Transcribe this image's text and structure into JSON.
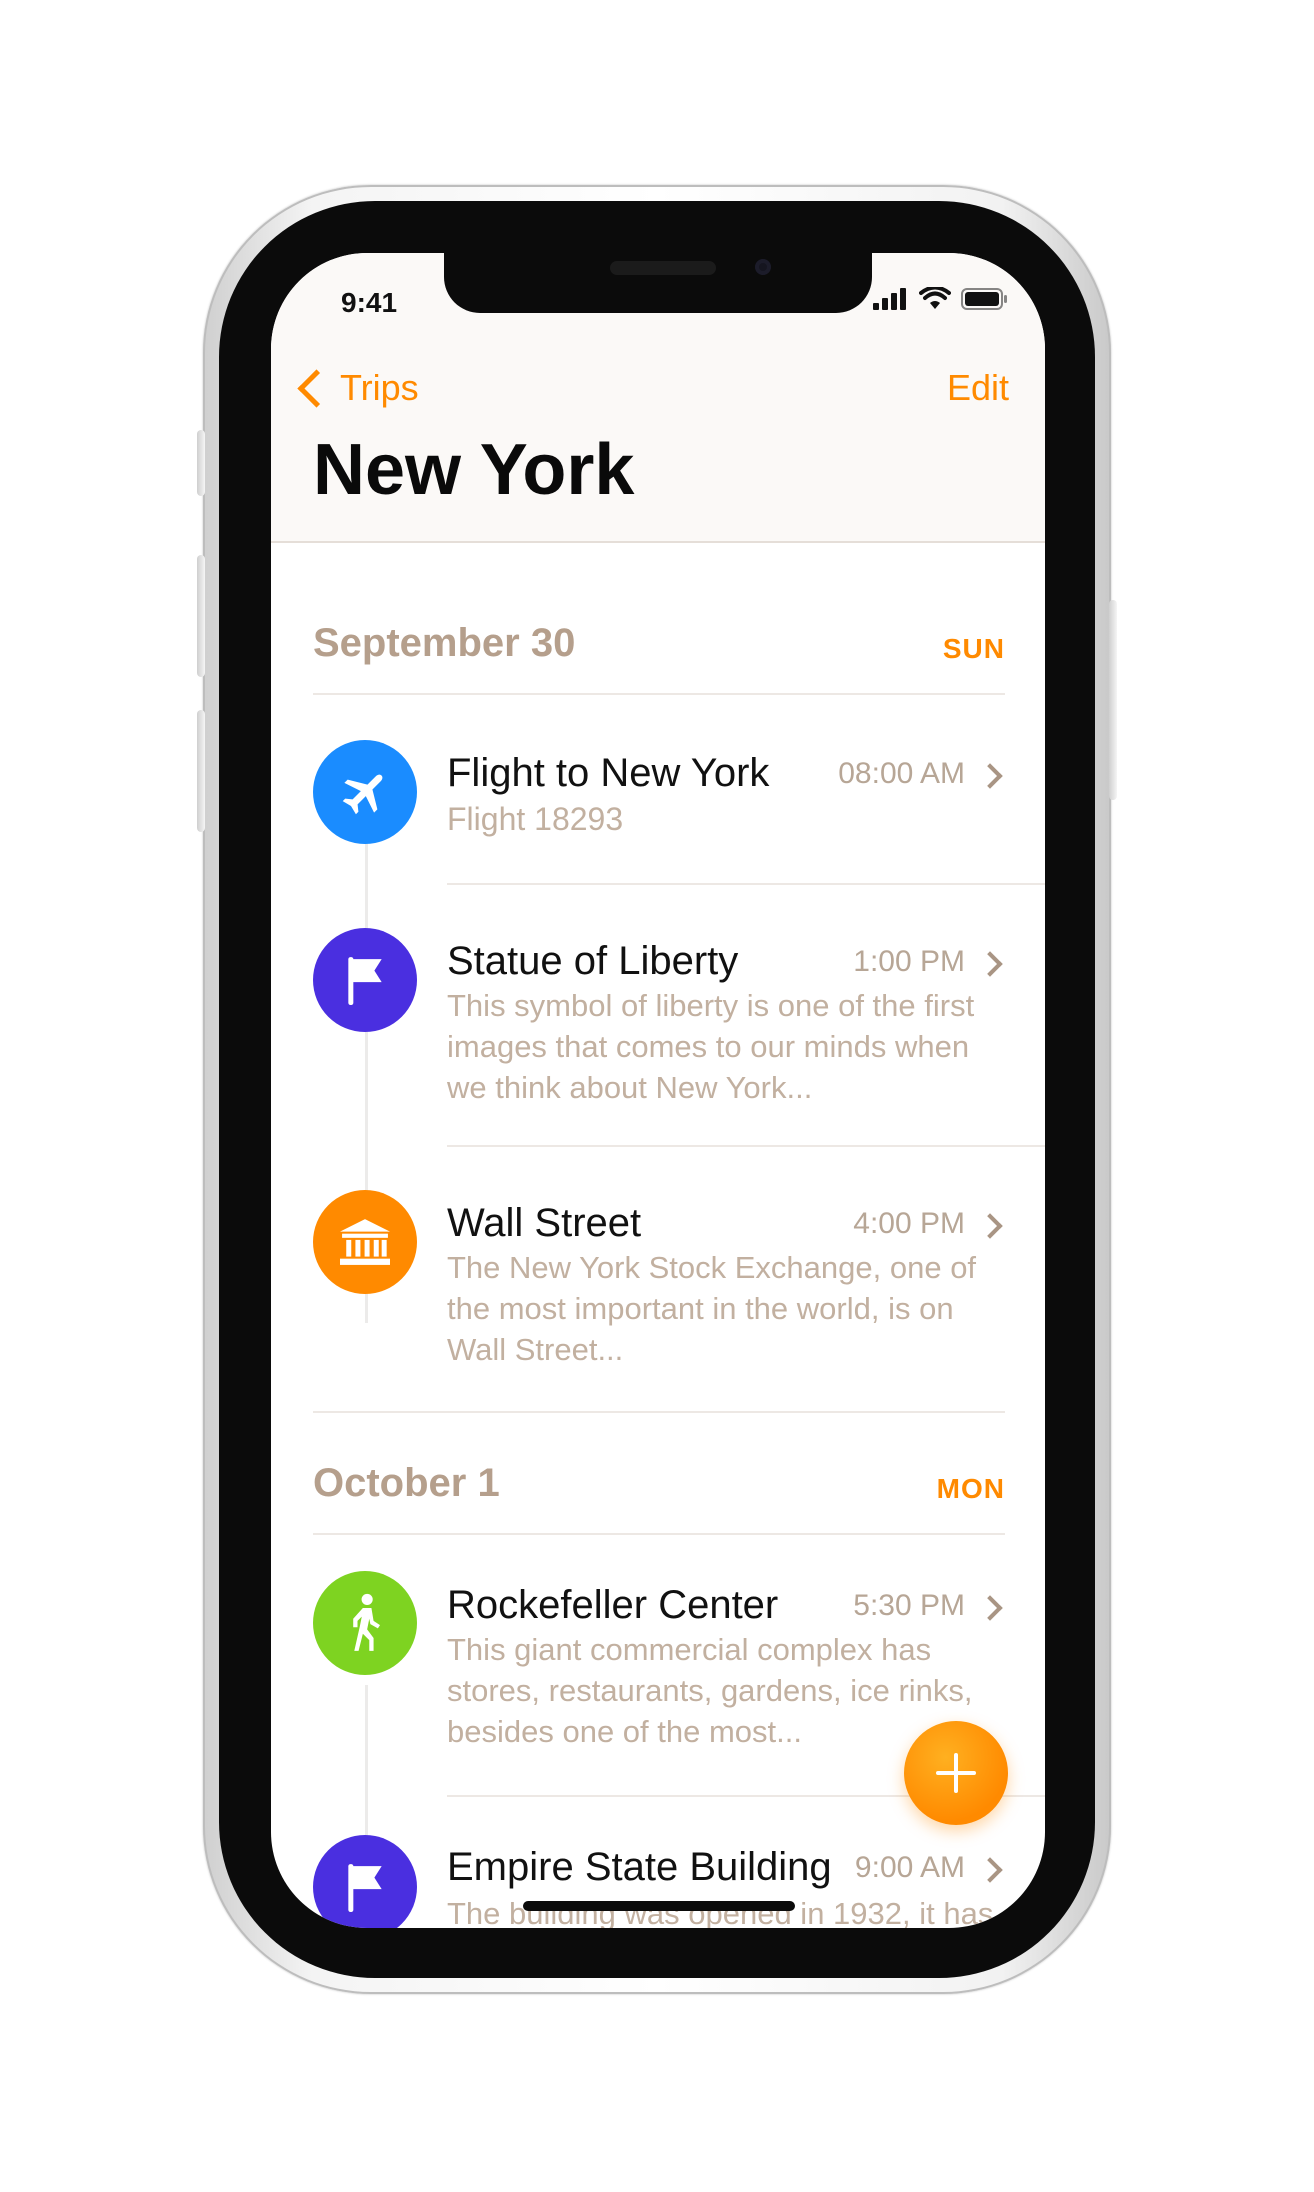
{
  "status_bar": {
    "time": "9:41"
  },
  "nav": {
    "back_label": "Trips",
    "edit_label": "Edit",
    "title": "New York"
  },
  "colors": {
    "accent": "#ff8a00",
    "flight": "#1a8cff",
    "landmark": "#4a2fe0",
    "finance": "#ff8a00",
    "walk": "#7ed321"
  },
  "sections": [
    {
      "date": "September 30",
      "day": "SUN",
      "items": [
        {
          "title": "Flight to New York",
          "time": "08:00 AM",
          "subtitle": "Flight 18293",
          "icon": "airplane-icon"
        },
        {
          "title": "Statue of Liberty",
          "time": "1:00 PM",
          "description": "This symbol of liberty is one of the first images that comes to our minds when we think about New York...",
          "icon": "flag-icon"
        },
        {
          "title": "Wall Street",
          "time": "4:00 PM",
          "description": "The New York Stock Exchange, one of the most important in the world, is on Wall Street...",
          "icon": "bank-icon"
        }
      ]
    },
    {
      "date": "October 1",
      "day": "MON",
      "items": [
        {
          "title": "Rockefeller Center",
          "time": "5:30 PM",
          "description": "This giant commercial complex has stores, restaurants, gardens, ice rinks, besides one of the most...",
          "icon": "walking-icon"
        },
        {
          "title": "Empire State Building",
          "time": "9:00 AM",
          "description": "The building was opened in 1932, it has",
          "icon": "flag-icon"
        }
      ]
    }
  ],
  "fab": {
    "icon": "plus-icon"
  }
}
